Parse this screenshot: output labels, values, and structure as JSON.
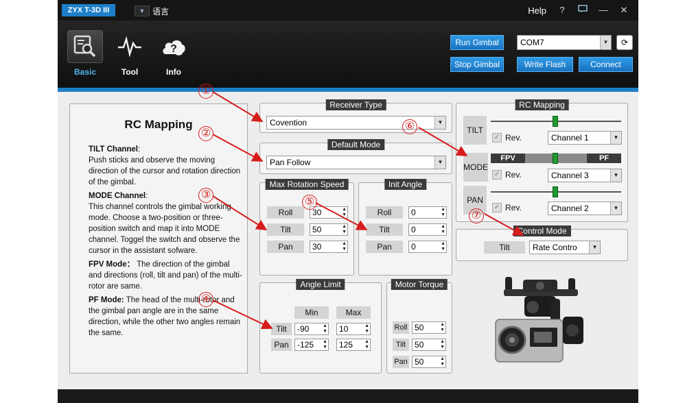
{
  "titlebar": {
    "app_name": "ZYX T-3D III",
    "language": "语言",
    "help": "Help"
  },
  "toolbar": {
    "tools": [
      {
        "label": "Basic",
        "icon": "search-monitor-icon"
      },
      {
        "label": "Tool",
        "icon": "pulse-icon"
      },
      {
        "label": "Info",
        "icon": "info-cloud-icon"
      }
    ],
    "run_gimbal": "Run Gimbal",
    "stop_gimbal": "Stop Gimbal",
    "port": "COM7",
    "write_flash": "Write Flash",
    "connect": "Connect"
  },
  "description": {
    "title": "RC Mapping",
    "tilt_heading": "TILT Channel",
    "tilt_colon": ":",
    "tilt_text": "Push sticks and observe the moving direction of the cursor and rotation direction of the gimbal.",
    "mode_heading": "MODE Channel",
    "mode_colon": ":",
    "mode_text": "This channel controls the gimbal working mode. Choose a two-position or three-position switch and map it into MODE channel. Toggel the switch and observe the cursor in the assistant sofware.",
    "fpv_heading": "FPV Mode：",
    "fpv_text": "The direction of the gimbal and directions (roll, tilt and pan) of the multi-rotor are same.",
    "pf_heading": "PF Mode:",
    "pf_text": "The head of the multi-rotor and the gimbal pan angle are in the same direction, while the other two angles remain the same."
  },
  "receiver_type": {
    "title": "Receiver Type",
    "value": "Covention"
  },
  "default_mode": {
    "title": "Default Mode",
    "value": "Pan Follow"
  },
  "max_rotation_speed": {
    "title": "Max Rotation Speed",
    "rows": [
      {
        "label": "Roll",
        "value": "30"
      },
      {
        "label": "Tilt",
        "value": "50"
      },
      {
        "label": "Pan",
        "value": "30"
      }
    ]
  },
  "init_angle": {
    "title": "Init Angle",
    "rows": [
      {
        "label": "Roll",
        "value": "0"
      },
      {
        "label": "Tilt",
        "value": "0"
      },
      {
        "label": "Pan",
        "value": "0"
      }
    ]
  },
  "angle_limit": {
    "title": "Angle Limit",
    "min_label": "Min",
    "max_label": "Max",
    "rows": [
      {
        "label": "Tilt",
        "min": "-90",
        "max": "10"
      },
      {
        "label": "Pan",
        "min": "-125",
        "max": "125"
      }
    ]
  },
  "motor_torque": {
    "title": "Motor Torque",
    "rows": [
      {
        "label": "Roll",
        "value": "50"
      },
      {
        "label": "Tilt",
        "value": "50"
      },
      {
        "label": "Pan",
        "value": "50"
      }
    ]
  },
  "rc_mapping": {
    "title": "RC Mapping",
    "rev_label": "Rev.",
    "fpv_label": "FPV",
    "pf_label": "PF",
    "channels": [
      {
        "label": "TILT",
        "channel": "Channel 1",
        "slider": 0.5
      },
      {
        "label": "MODE",
        "channel": "Channel 3",
        "slider": 0.5
      },
      {
        "label": "PAN",
        "channel": "Channel 2",
        "slider": 0.5
      }
    ]
  },
  "control_mode": {
    "title": "Control Mode",
    "label": "Tilt",
    "value": "Rate Contro"
  },
  "callouts": [
    "①",
    "②",
    "③",
    "④",
    "⑤",
    "⑥",
    "⑦"
  ],
  "colors": {
    "accent": "#1e7fc8",
    "callout": "#d81c1c",
    "slider_thumb": "#1e9c2e"
  }
}
